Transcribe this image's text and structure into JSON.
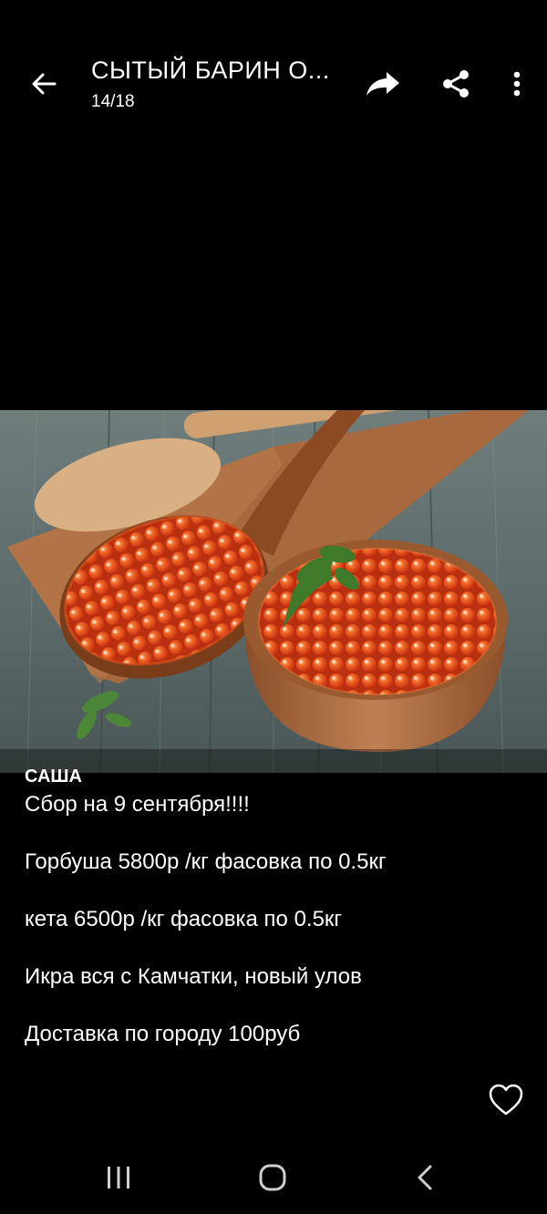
{
  "header": {
    "title": "СЫТЫЙ БАРИН О...",
    "counter": "14/18"
  },
  "icons": {
    "back": "arrow-left-icon",
    "forward": "forward-share-icon",
    "share": "share-icon",
    "menu": "more-vertical-icon",
    "like": "heart-icon"
  },
  "post": {
    "author": "САША",
    "lines": [
      "Сбор на 9 сентября!!!!",
      "Горбуша 5800р /кг фасовка по 0.5кг",
      "кета 6500р /кг фасовка по 0.5кг",
      "Икра вся с Камчатки, новый улов",
      "Доставка по городу 100руб"
    ]
  },
  "colors": {
    "background": "#000000",
    "text": "#ffffff",
    "caviar": "#e8461c"
  }
}
